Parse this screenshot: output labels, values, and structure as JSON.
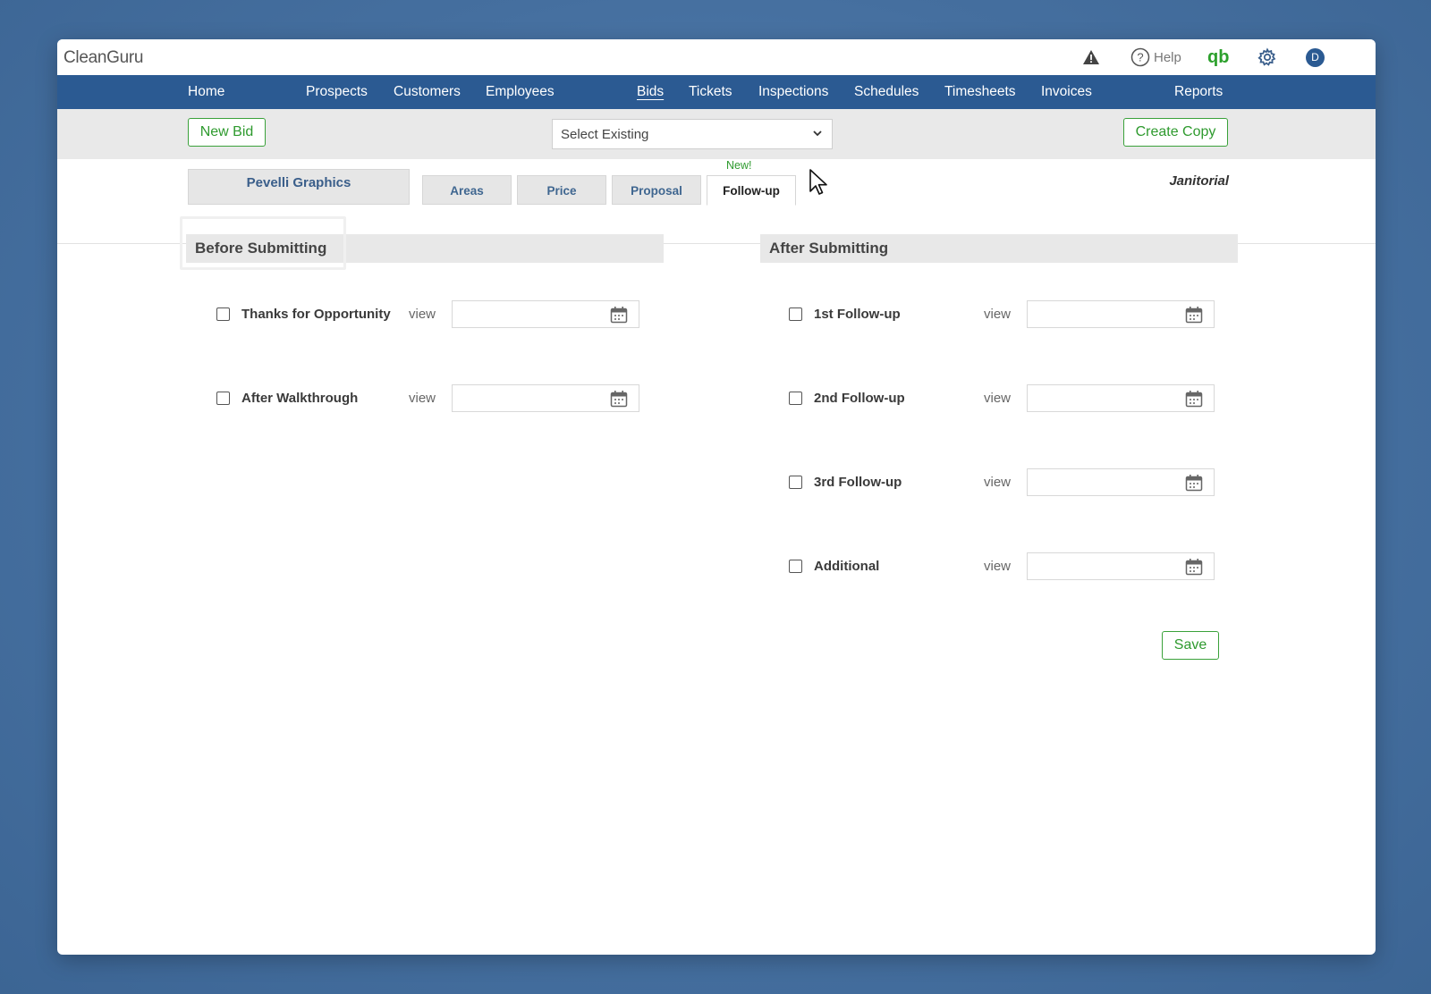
{
  "app": {
    "logo": "CleanGuru",
    "help_label": "Help",
    "qb_label": "qb",
    "avatar_initial": "D",
    "icons": [
      "warning-icon",
      "help-icon",
      "quickbooks-icon",
      "gear-icon",
      "avatar"
    ]
  },
  "nav": {
    "items": [
      {
        "label": "Home"
      },
      {
        "label": "Prospects"
      },
      {
        "label": "Customers"
      },
      {
        "label": "Employees"
      },
      {
        "label": "Bids",
        "active": true
      },
      {
        "label": "Tickets"
      },
      {
        "label": "Inspections"
      },
      {
        "label": "Schedules"
      },
      {
        "label": "Timesheets"
      },
      {
        "label": "Invoices"
      },
      {
        "label": "Reports"
      }
    ]
  },
  "toolbar": {
    "new_bid_label": "New Bid",
    "select_value": "Select Existing",
    "create_copy_label": "Create Copy"
  },
  "tabs": {
    "client_name": "Pevelli Graphics",
    "items": [
      {
        "label": "Areas"
      },
      {
        "label": "Price"
      },
      {
        "label": "Proposal"
      },
      {
        "label": "Follow-up",
        "active": true
      }
    ],
    "new_badge": "New!",
    "category": "Janitorial"
  },
  "before": {
    "title": "Before Submitting",
    "rows": [
      {
        "label": "Thanks for Opportunity",
        "view": "view",
        "date": ""
      },
      {
        "label": "After Walkthrough",
        "view": "view",
        "date": ""
      }
    ]
  },
  "after": {
    "title": "After Submitting",
    "rows": [
      {
        "label": "1st Follow-up",
        "view": "view",
        "date": ""
      },
      {
        "label": "2nd Follow-up",
        "view": "view",
        "date": ""
      },
      {
        "label": "3rd Follow-up",
        "view": "view",
        "date": ""
      },
      {
        "label": "Additional",
        "view": "view",
        "date": ""
      }
    ],
    "save_label": "Save"
  },
  "colors": {
    "nav_bg": "#2b5a92",
    "accent_green": "#2e9a2e",
    "tab_text": "#3f6690"
  }
}
